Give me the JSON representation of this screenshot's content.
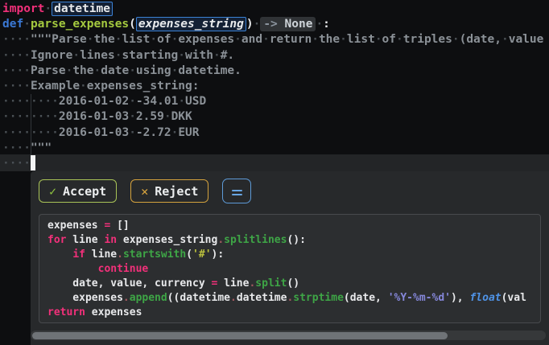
{
  "colors": {
    "editor_bg": "#0d0e10",
    "panel_bg": "#27292b",
    "keyword_pink": "#f2307a",
    "def_blue": "#3a78d4",
    "function_green": "#a4c93f",
    "param_orange": "#fb9b31",
    "method_green": "#3ea546",
    "string_yellow": "#bcc13d",
    "string_purple": "#8587da",
    "accept_green": "#a9c457",
    "reject_amber": "#d4a23d",
    "menu_blue": "#5e9bd8"
  },
  "editor": {
    "lines": [
      [
        {
          "t": "import",
          "s": "kw"
        },
        {
          "t": "·",
          "s": "fg"
        },
        {
          "t": "datetime",
          "s": "boxed"
        }
      ],
      [
        {
          "t": "def",
          "s": "def"
        },
        {
          "t": "·",
          "s": "fg"
        },
        {
          "t": "parse_expenses",
          "s": "fn"
        },
        {
          "t": "(",
          "s": "fg"
        },
        {
          "t": "expenses_string",
          "s": "param boxed"
        },
        {
          "t": ")·",
          "s": "fg"
        },
        {
          "t": "->",
          "s": "chipl"
        },
        {
          "t": " None",
          "s": "chipr"
        },
        {
          "t": "·:",
          "s": "fg"
        }
      ],
      [
        {
          "t": "····\"\"\"Parse·the·list·of·expenses·and·return·the·list·of·triples·(date,·value",
          "s": "doc"
        }
      ],
      [
        {
          "t": "····Ignore·lines·starting·with·#.",
          "s": "doc"
        }
      ],
      [
        {
          "t": "····Parse·the·date·using·datetime.",
          "s": "doc"
        }
      ],
      [
        {
          "t": "····Example·expenses_string:",
          "s": "doc"
        }
      ],
      [
        {
          "t": "········2016-01-02·-34.01·USD",
          "s": "doc"
        }
      ],
      [
        {
          "t": "········2016-01-03·2.59·DKK",
          "s": "doc"
        }
      ],
      [
        {
          "t": "········2016-01-03·-2.72·EUR",
          "s": "doc"
        }
      ],
      [
        {
          "t": "····\"\"\"",
          "s": "doc"
        }
      ],
      [
        {
          "t": "····",
          "s": "doc"
        }
      ]
    ]
  },
  "panel": {
    "accept_icon": "✓",
    "accept_label": "Accept",
    "reject_icon": "✕",
    "reject_label": "Reject",
    "suggestion": {
      "lines": [
        [
          {
            "t": "expenses ",
            "s": "fg"
          },
          {
            "t": "=",
            "s": "kw"
          },
          {
            "t": " []",
            "s": "fg"
          }
        ],
        [
          {
            "t": "for",
            "s": "kw"
          },
          {
            "t": " line ",
            "s": "fg"
          },
          {
            "t": "in",
            "s": "kw"
          },
          {
            "t": " expenses_string",
            "s": "fg"
          },
          {
            "t": ".",
            "s": "dotc"
          },
          {
            "t": "splitlines",
            "s": "meth"
          },
          {
            "t": "():",
            "s": "fg"
          }
        ],
        [
          {
            "t": "    ",
            "s": "fg"
          },
          {
            "t": "if",
            "s": "kw"
          },
          {
            "t": " line",
            "s": "fg"
          },
          {
            "t": ".",
            "s": "dotc"
          },
          {
            "t": "startswith",
            "s": "meth"
          },
          {
            "t": "(",
            "s": "fg"
          },
          {
            "t": "'#'",
            "s": "str"
          },
          {
            "t": "):",
            "s": "fg"
          }
        ],
        [
          {
            "t": "        ",
            "s": "fg"
          },
          {
            "t": "continue",
            "s": "kw"
          }
        ],
        [
          {
            "t": "    date, value, currency ",
            "s": "fg"
          },
          {
            "t": "=",
            "s": "kw"
          },
          {
            "t": " line",
            "s": "fg"
          },
          {
            "t": ".",
            "s": "dotc"
          },
          {
            "t": "split",
            "s": "meth"
          },
          {
            "t": "()",
            "s": "fg"
          }
        ],
        [
          {
            "t": "    expenses",
            "s": "fg"
          },
          {
            "t": ".",
            "s": "dotc"
          },
          {
            "t": "append",
            "s": "meth"
          },
          {
            "t": "((datetime",
            "s": "fg"
          },
          {
            "t": ".",
            "s": "dotc"
          },
          {
            "t": "datetime",
            "s": "fg"
          },
          {
            "t": ".",
            "s": "dotc"
          },
          {
            "t": "strptime",
            "s": "meth"
          },
          {
            "t": "(date, ",
            "s": "fg"
          },
          {
            "t": "'%Y-%m-%d'",
            "s": "str2"
          },
          {
            "t": "), ",
            "s": "fg"
          },
          {
            "t": "float",
            "s": "flt"
          },
          {
            "t": "(val",
            "s": "fg"
          }
        ],
        [
          {
            "t": "return",
            "s": "kw"
          },
          {
            "t": " expenses",
            "s": "fg"
          }
        ]
      ]
    }
  }
}
